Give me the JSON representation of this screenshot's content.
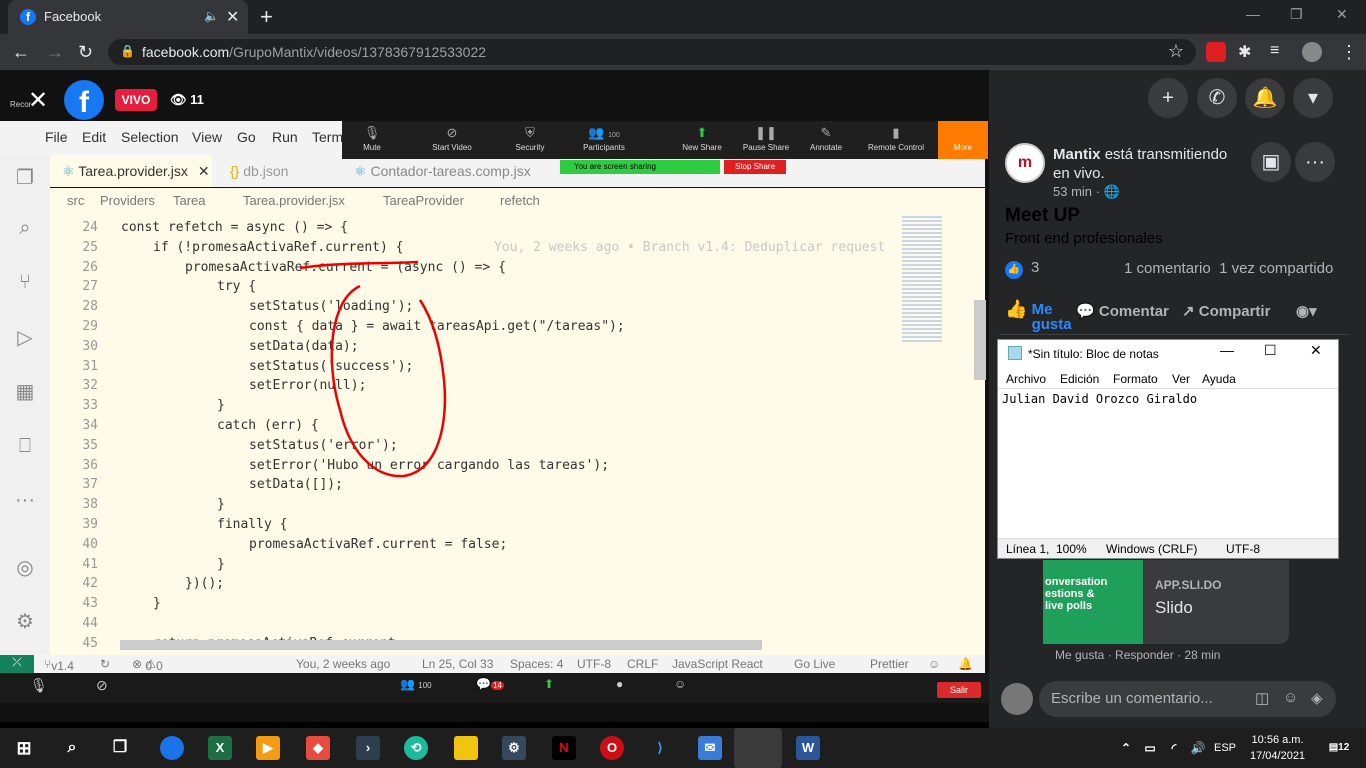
{
  "browser": {
    "tab_title": "Facebook",
    "url_host": "facebook.com",
    "url_path": "/GrupoMantix/videos/1378367912533022"
  },
  "live": {
    "badge": "VIVO",
    "viewers": "11",
    "recording_label": "Recor"
  },
  "zoom": {
    "top_buttons": [
      "Mute",
      "Start Video",
      "Security",
      "Participants",
      "New Share",
      "Pause Share",
      "Annotate",
      "Remote Control"
    ],
    "participants_count": "100",
    "more_label": "More",
    "sharing_label": "You are screen sharing",
    "stop_share": "Stop Share",
    "bottom_participants": "100",
    "bottom_chat_count": "14",
    "salir": "Salir"
  },
  "vscode": {
    "menu": [
      "File",
      "Edit",
      "Selection",
      "View",
      "Go",
      "Run",
      "Term"
    ],
    "tabs": [
      "Tarea.provider.jsx",
      "db.json",
      "Contador-tareas.comp.jsx"
    ],
    "breadcrumb": [
      "src",
      "Providers",
      "Tarea",
      "Tarea.provider.jsx",
      "TareaProvider",
      "refetch"
    ],
    "blame": "You, 2 weeks ago • Branch v1.4: Deduplicar request",
    "status": {
      "branch": "v1.4",
      "errors": "0",
      "warnings": "0",
      "blame": "You, 2 weeks ago",
      "position": "Ln 25, Col 33",
      "spaces": "Spaces: 4",
      "encoding": "UTF-8",
      "eol": "CRLF",
      "language": "JavaScript React",
      "golive": "Go Live",
      "prettier": "Prettier"
    }
  },
  "code_lines": [
    {
      "n": "24",
      "indent": 2,
      "t": "const refetch = async () => {"
    },
    {
      "n": "25",
      "indent": 3,
      "t": "if (!promesaActivaRef.current) {"
    },
    {
      "n": "26",
      "indent": 4,
      "t": "promesaActivaRef.current = (async () => {"
    },
    {
      "n": "27",
      "indent": 5,
      "t": "try {"
    },
    {
      "n": "28",
      "indent": 6,
      "t": "setStatus('loading');"
    },
    {
      "n": "29",
      "indent": 6,
      "t": "const { data } = await tareasApi.get(\"/tareas\");"
    },
    {
      "n": "30",
      "indent": 6,
      "t": "setData(data);"
    },
    {
      "n": "31",
      "indent": 6,
      "t": "setStatus('success');"
    },
    {
      "n": "32",
      "indent": 6,
      "t": "setError(null);"
    },
    {
      "n": "33",
      "indent": 5,
      "t": "}"
    },
    {
      "n": "34",
      "indent": 5,
      "t": "catch (err) {"
    },
    {
      "n": "35",
      "indent": 6,
      "t": "setStatus('error');"
    },
    {
      "n": "36",
      "indent": 6,
      "t": "setError('Hubo un error cargando las tareas');"
    },
    {
      "n": "37",
      "indent": 6,
      "t": "setData([]);"
    },
    {
      "n": "38",
      "indent": 5,
      "t": "}"
    },
    {
      "n": "39",
      "indent": 5,
      "t": "finally {"
    },
    {
      "n": "40",
      "indent": 6,
      "t": "promesaActivaRef.current = false;"
    },
    {
      "n": "41",
      "indent": 5,
      "t": "}"
    },
    {
      "n": "42",
      "indent": 4,
      "t": "})();"
    },
    {
      "n": "43",
      "indent": 3,
      "t": "}"
    },
    {
      "n": "44",
      "indent": 0,
      "t": ""
    },
    {
      "n": "45",
      "indent": 3,
      "t": "return promesaActivaRef.current;"
    }
  ],
  "post": {
    "author": "Mantix",
    "action": "está transmitiendo en vivo.",
    "time": "53 min ·",
    "title": "Meet UP",
    "subtitle": "Front end profesionales",
    "likes": "3",
    "comments": "1 comentario",
    "shares": "1 vez compartido",
    "like_btn": "Me gusta",
    "comment_btn": "Comentar",
    "share_btn": "Compartir"
  },
  "notepad": {
    "title": "*Sin título: Bloc de notas",
    "menu": [
      "Archivo",
      "Edición",
      "Formato",
      "Ver",
      "Ayuda"
    ],
    "content": "Julian David Orozco Giraldo",
    "status": [
      "Línea 1,",
      "100%",
      "Windows (CRLF)",
      "UTF-8"
    ]
  },
  "slido": {
    "thumb_text": "onversation\nestions &\nlive polls",
    "host": "APP.SLI.DO",
    "name": "Slido",
    "actions": "Me gusta · Responder · 28 min"
  },
  "comment_placeholder": "Escribe un comentario...",
  "taskbar": {
    "lang": "ESP",
    "time": "10:56 a.m.",
    "date": "17/04/2021",
    "notif": "12"
  }
}
